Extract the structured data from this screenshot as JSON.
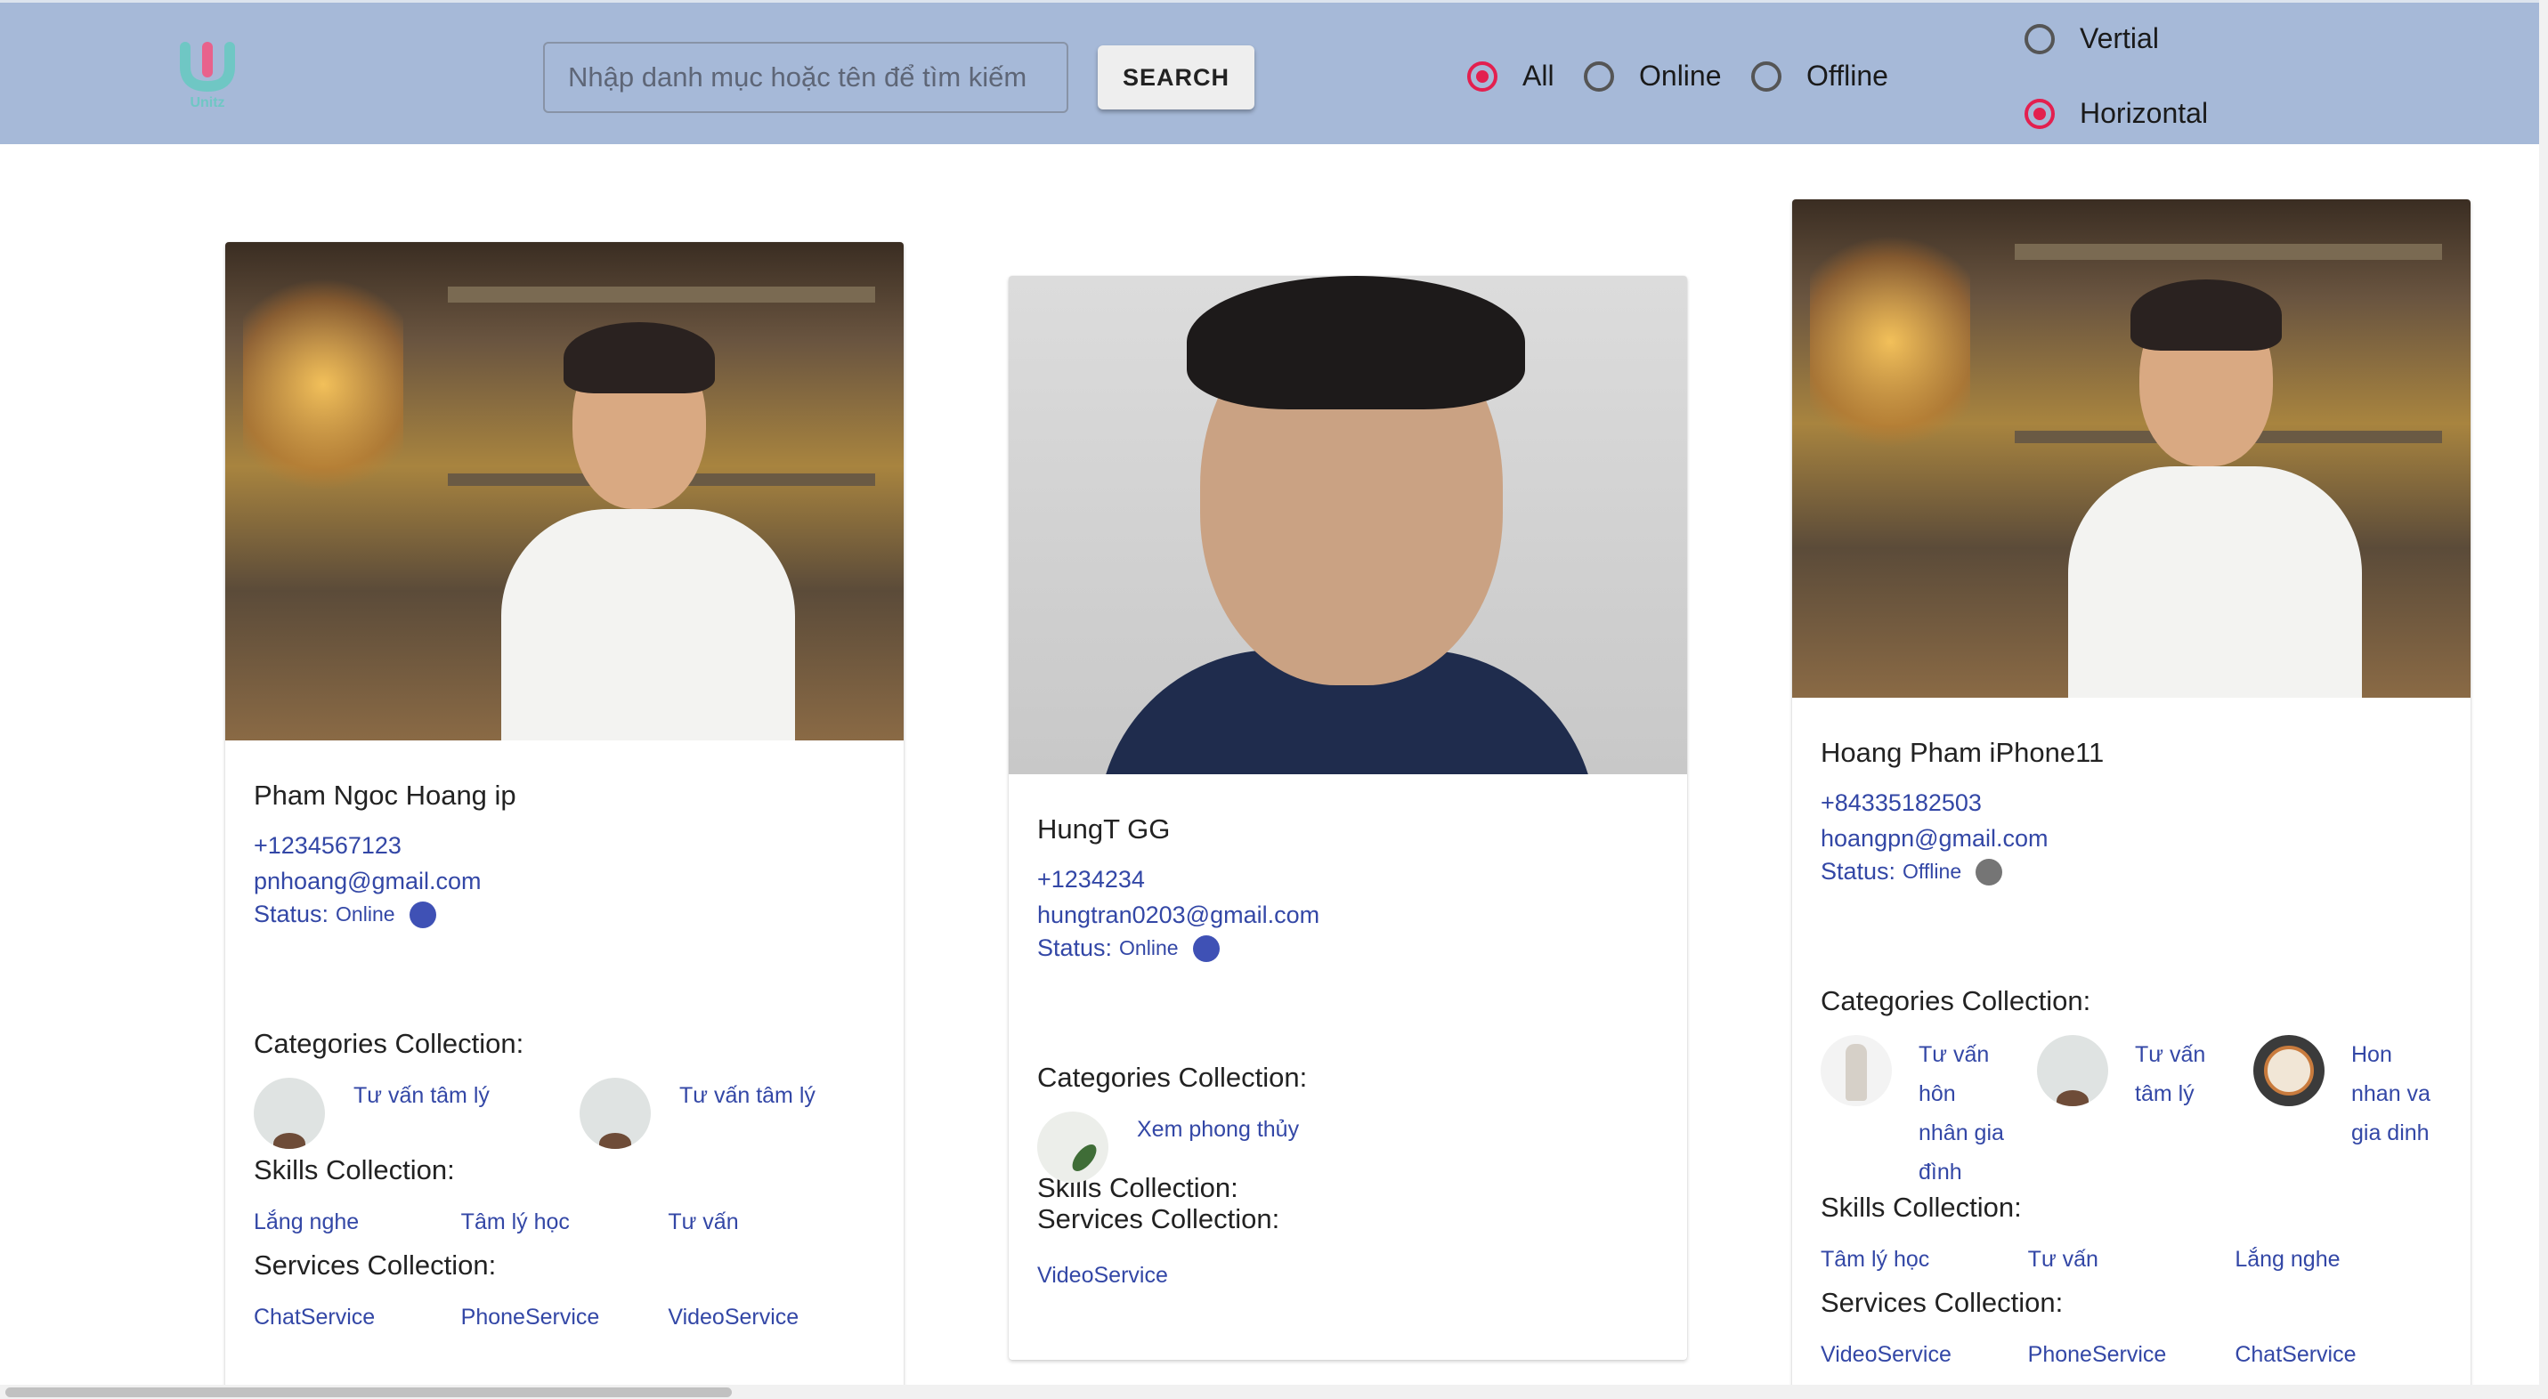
{
  "logo": {
    "text": "Unitz"
  },
  "search": {
    "placeholder": "Nhập danh mục hoặc tên để tìm kiếm",
    "button": "SEARCH"
  },
  "status_filter": {
    "options": [
      "All",
      "Online",
      "Offline"
    ],
    "selected": "All"
  },
  "layout_filter": {
    "options": [
      "Vertial",
      "Horizontal"
    ],
    "selected": "Horizontal"
  },
  "labels": {
    "status": "Status:",
    "categories": "Categories Collection:",
    "skills": "Skills Collection:",
    "services": "Services Collection:"
  },
  "colors": {
    "online": "#3f51b5",
    "offline": "#757575",
    "accent": "#e3204f",
    "header": "#a6b9d8",
    "link": "#3347a6"
  },
  "cards": [
    {
      "name": "Pham Ngoc Hoang ip",
      "phone": "+1234567123",
      "email": "pnhoang@gmail.com",
      "status": "Online",
      "categories": [
        {
          "label": "Tư vấn tâm lý",
          "icon": "coffee-cup-image"
        },
        {
          "label": "Tư vấn tâm lý",
          "icon": "coffee-cup-image"
        }
      ],
      "skills": [
        "Lắng nghe",
        "Tâm lý học",
        "Tư vấn"
      ],
      "services": [
        "ChatService",
        "PhoneService",
        "VideoService"
      ]
    },
    {
      "name": "HungT GG",
      "phone": "+1234234",
      "email": "hungtran0203@gmail.com",
      "status": "Online",
      "categories": [
        {
          "label": "Xem phong thủy",
          "icon": "plant-image"
        }
      ],
      "skills": [],
      "services": [
        "VideoService"
      ]
    },
    {
      "name": "Hoang Pham iPhone11",
      "phone": "+84335182503",
      "email": "hoangpn@gmail.com",
      "status": "Offline",
      "categories": [
        {
          "label_lines": [
            "Tư vấn",
            "hôn",
            "nhân gia",
            "đình"
          ],
          "icon": "dress-image"
        },
        {
          "label_lines": [
            "Tư vấn",
            "tâm lý"
          ],
          "icon": "coffee-cup-image"
        },
        {
          "label_lines": [
            "Hon",
            "nhan va",
            "gia dinh"
          ],
          "icon": "food-image"
        }
      ],
      "skills": [
        "Tâm lý học",
        "Tư vấn",
        "Lắng nghe"
      ],
      "services": [
        "VideoService",
        "PhoneService",
        "ChatService"
      ]
    }
  ]
}
